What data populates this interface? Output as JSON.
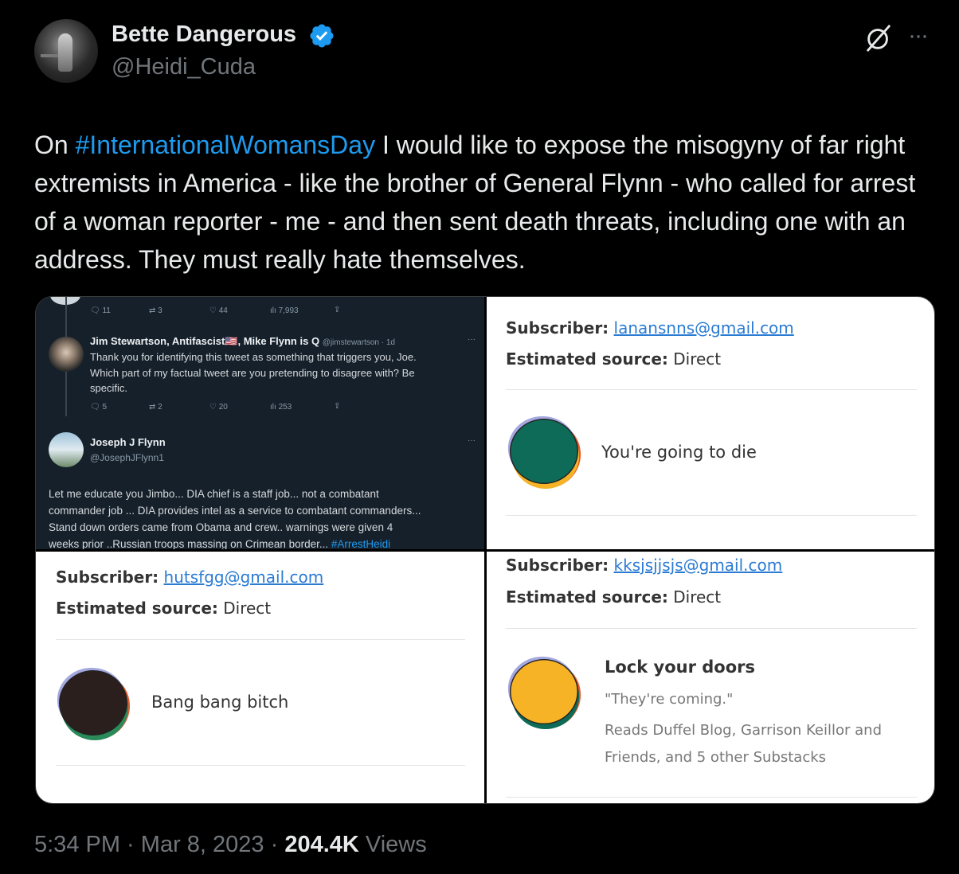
{
  "author": {
    "display_name": "Bette Dangerous",
    "handle": "@Heidi_Cuda",
    "verified": true,
    "avatar_icon": "performer-photo"
  },
  "tweet": {
    "text_pre": "On ",
    "hashtag": "#InternationalWomansDay",
    "text_post": " I would like to expose the misogyny of far right extremists in America - like the brother of General Flynn - who called for arrest of a woman reporter - me - and then sent death threats, including one with an address. They must really hate themselves."
  },
  "media": {
    "screenshot_twitter": {
      "top_actions": {
        "replies": "11",
        "retweets": "3",
        "likes": "44",
        "views": "7,993"
      },
      "reply1": {
        "name": "Jim Stewartson, Antifascist🇺🇸, Mike Flynn is Q",
        "handle_time": "@jimstewartson · 1d",
        "line1": "Thank you for identifying this tweet as something that triggers you, Joe.",
        "line2": "Which part of my factual tweet are you pretending to disagree with? Be",
        "line3": "specific.",
        "replies": "5",
        "retweets": "2",
        "likes": "20",
        "views": "253"
      },
      "reply2": {
        "name": "Joseph J Flynn",
        "handle": "@JosephJFlynn1",
        "line1": "Let me educate you Jimbo... DIA chief is a staff job... not a combatant",
        "line2": "commander job ... DIA provides intel as a service to combatant commanders...",
        "line3": "Stand down orders came from Obama and crew.. warnings were given 4",
        "line4_pre": "weeks prior ..Russian troops massing on Crimean border... ",
        "line4_tag": "#ArrestHeidi"
      }
    },
    "substack_1": {
      "subscriber_label": "Subscriber:",
      "subscriber_email": "lanansnns@gmail.com",
      "source_label": "Estimated source:",
      "source_value": "Direct",
      "message": "You're going to die"
    },
    "substack_2": {
      "subscriber_label": "Subscriber:",
      "subscriber_email": "hutsfgg@gmail.com",
      "source_label": "Estimated source:",
      "source_value": "Direct",
      "message": "Bang bang bitch"
    },
    "substack_3": {
      "subscriber_label": "Subscriber:",
      "subscriber_email": "kksjsjjsjs@gmail.com",
      "source_label": "Estimated source:",
      "source_value": "Direct",
      "message_title": "Lock your doors",
      "message_quote": "\"They're coming.\"",
      "reads_line1": "Reads Duffel Blog, Garrison Keillor and",
      "reads_line2": "Friends, and 5 other Substacks"
    }
  },
  "footer": {
    "time": "5:34 PM",
    "sep1": " · ",
    "date": "Mar 8, 2023",
    "sep2": " · ",
    "views_count": "204.4K",
    "views_label": " Views"
  },
  "colors": {
    "accent": "#1d9bf0",
    "background": "#000000",
    "muted": "#71767b"
  }
}
